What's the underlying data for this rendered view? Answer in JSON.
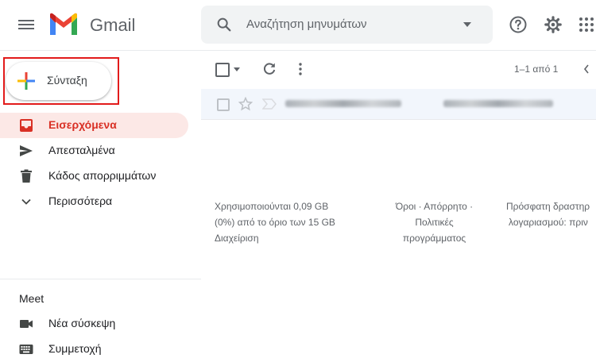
{
  "header": {
    "app_name": "Gmail",
    "search_placeholder": "Αναζήτηση μηνυμάτων"
  },
  "compose": {
    "label": "Σύνταξη"
  },
  "nav": {
    "items": [
      {
        "label": "Εισερχόμενα",
        "icon": "inbox-icon",
        "active": true
      },
      {
        "label": "Απεσταλμένα",
        "icon": "send-icon"
      },
      {
        "label": "Κάδος απορριμμάτων",
        "icon": "trash-icon"
      },
      {
        "label": "Περισσότερα",
        "icon": "chevron-down-icon"
      }
    ]
  },
  "meet": {
    "title": "Meet",
    "items": [
      {
        "label": "Νέα σύσκεψη",
        "icon": "videocam-icon"
      },
      {
        "label": "Συμμετοχή",
        "icon": "keyboard-icon"
      }
    ]
  },
  "toolbar": {
    "pager": "1–1 από 1"
  },
  "footer": {
    "storage_line1": "Χρησιμοποιούνται 0,09 GB",
    "storage_line2": "(0%) από το όριο των 15 GB",
    "manage": "Διαχείριση",
    "terms_line1": "Όροι · Απόρρητο · Πολιτικές",
    "terms_line2": "προγράμματος",
    "activity_line1": "Πρόσφατη δραστηρ",
    "activity_line2": "λογαριασμού: πριν"
  },
  "colors": {
    "accent_red": "#d93025",
    "highlight_border": "#e21b1b",
    "active_bg": "#fce8e6"
  }
}
